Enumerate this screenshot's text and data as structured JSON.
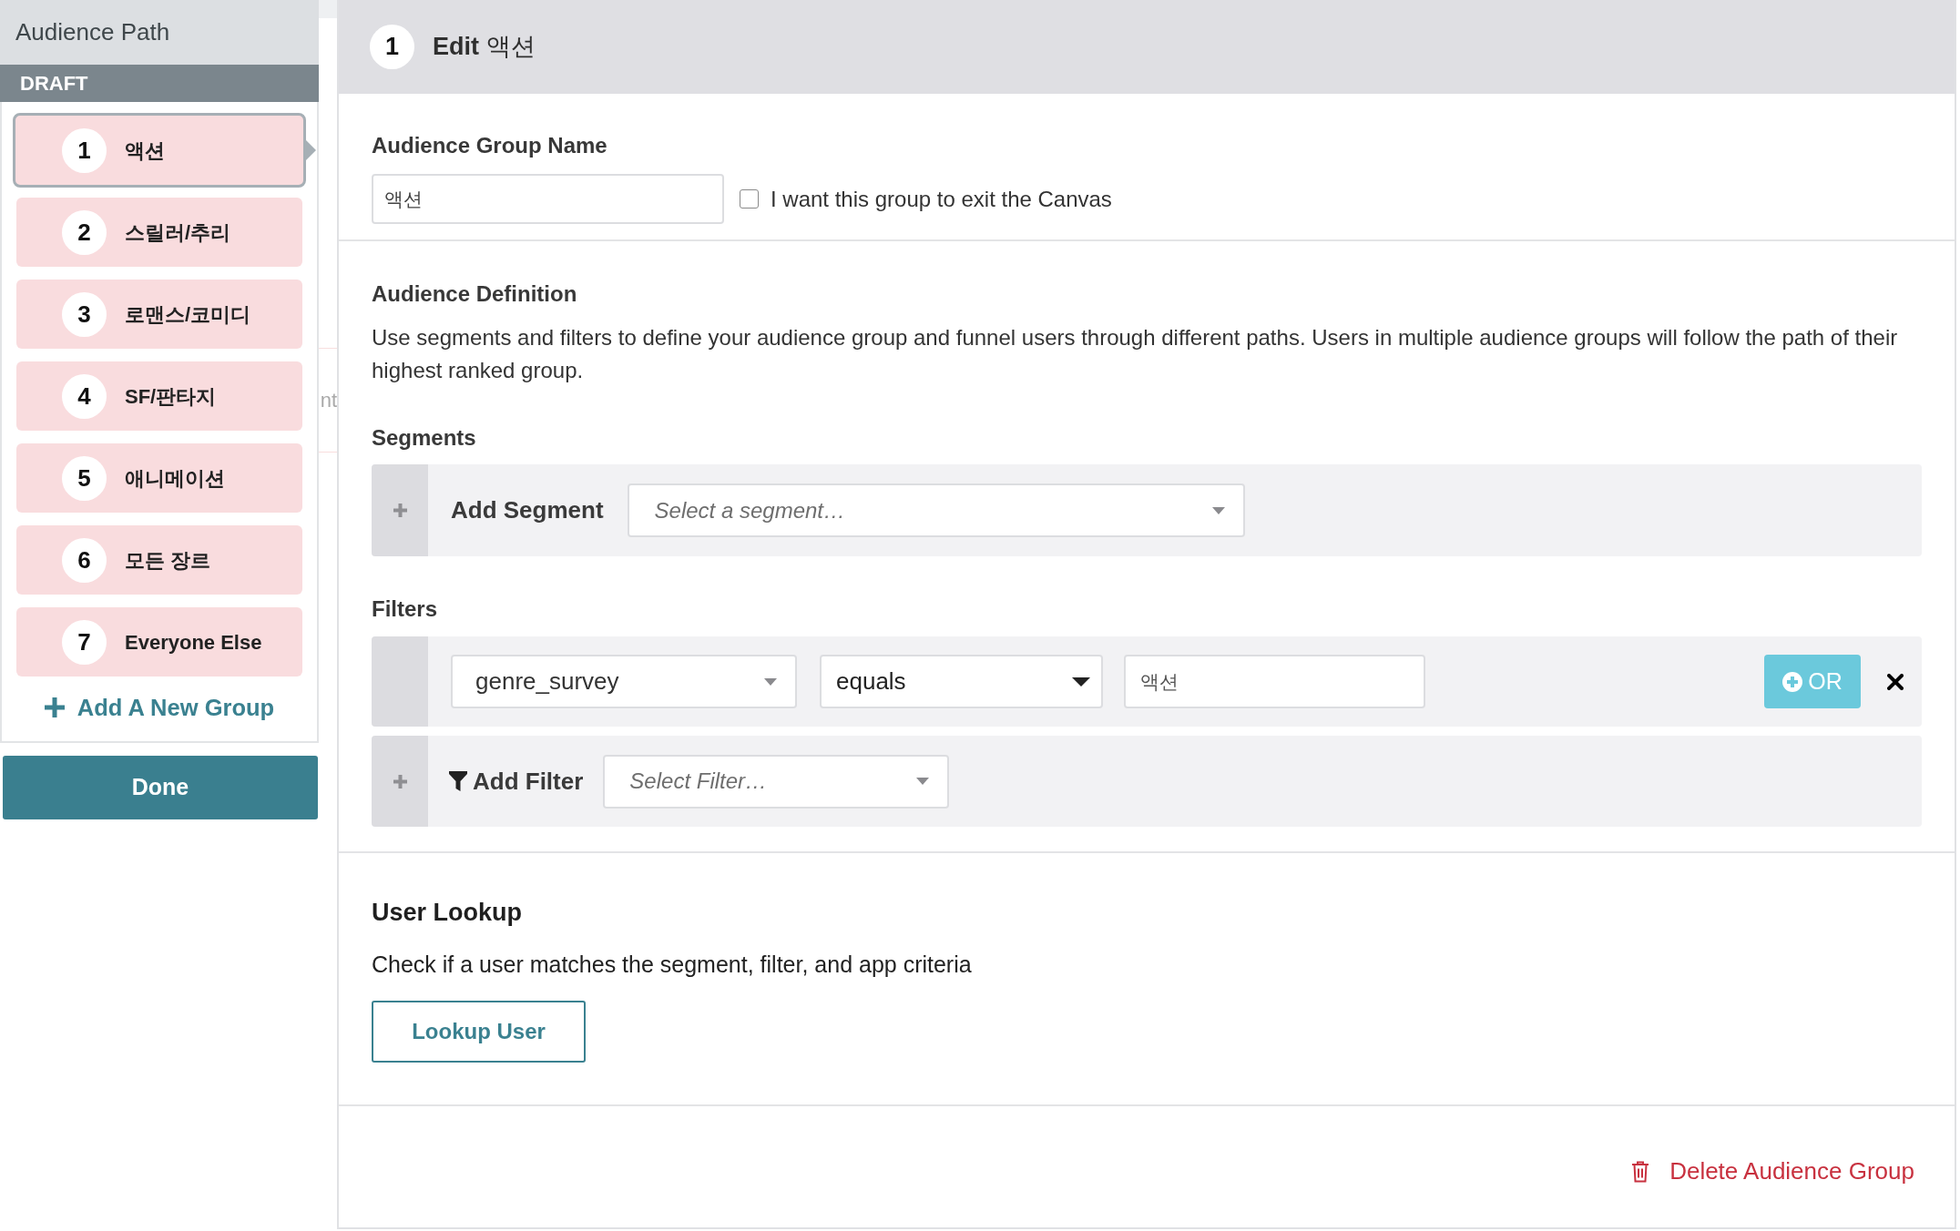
{
  "sidebar": {
    "title": "Audience Path",
    "status": "DRAFT",
    "groups": [
      {
        "number": "1",
        "label": "액션",
        "selected": true
      },
      {
        "number": "2",
        "label": "스릴러/추리",
        "selected": false
      },
      {
        "number": "3",
        "label": "로맨스/코미디",
        "selected": false
      },
      {
        "number": "4",
        "label": "SF/판타지",
        "selected": false
      },
      {
        "number": "5",
        "label": "애니메이션",
        "selected": false
      },
      {
        "number": "6",
        "label": "모든 장르",
        "selected": false
      },
      {
        "number": "7",
        "label": "Everyone Else",
        "selected": false
      }
    ],
    "add_group": "Add A New Group",
    "done_button": "Done"
  },
  "canvas_fragment": "nt",
  "editor": {
    "step": "1",
    "title": "**Edit** 액션",
    "group_name": {
      "label": "Audience Group Name",
      "value": "액션",
      "exit_option": {
        "label": "I want this group to exit the Canvas",
        "checked": false
      }
    },
    "definition": {
      "title": "Audience Definition",
      "description": "Use segments and filters to define your audience group and funnel users through different paths. Users in multiple audience groups will follow the path of their highest ranked group.",
      "segments": {
        "label": "Segments",
        "add_label": "Add Segment",
        "placeholder": "Select a segment…"
      },
      "filters": {
        "label": "Filters",
        "rows": [
          {
            "property": "genre_survey",
            "operator": "equals",
            "value": "액션",
            "or_button": "OR"
          }
        ],
        "add_label": "Add Filter",
        "placeholder": "Select Filter…"
      }
    },
    "lookup": {
      "title": "User Lookup",
      "description": "Check if a user matches the segment, filter, and app criteria",
      "button": "Lookup User"
    },
    "delete_button": "Delete Audience Group"
  }
}
